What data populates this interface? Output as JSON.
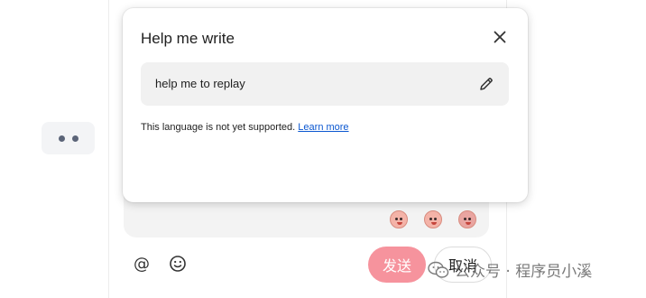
{
  "popup": {
    "title": "Help me write",
    "prompt_text": "help me to replay",
    "notice_text": "This language is not yet supported.",
    "learn_more_label": "Learn more"
  },
  "composer": {
    "emojis": [
      "crying-face-emoji",
      "sad-face-emoji",
      "upset-face-emoji"
    ]
  },
  "toolbar": {
    "at_symbol": "@",
    "emoji_symbol": "☺",
    "send_label": "发送",
    "cancel_label": "取消"
  },
  "watermark": {
    "text": "公众号 · 程序员小溪"
  },
  "colors": {
    "send_button": "#f6939d",
    "link": "#0b57d0",
    "prompt_bg": "#f1f1f1"
  }
}
